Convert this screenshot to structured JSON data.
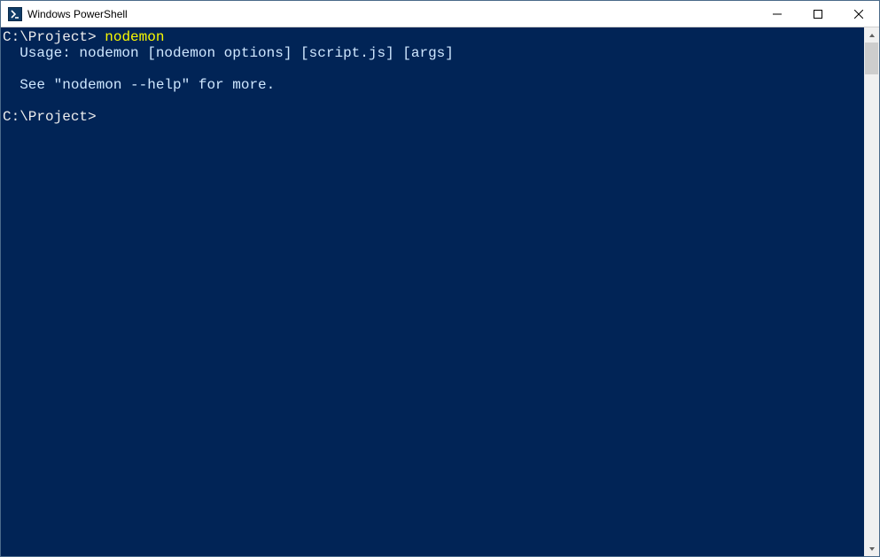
{
  "window": {
    "title": "Windows PowerShell"
  },
  "terminal": {
    "lines": [
      {
        "type": "prompt",
        "prompt": "C:\\Project>",
        "command": "nodemon"
      },
      {
        "type": "output",
        "text": "  Usage: nodemon [nodemon options] [script.js] [args]"
      },
      {
        "type": "blank"
      },
      {
        "type": "output",
        "text": "  See \"nodemon --help\" for more."
      },
      {
        "type": "blank"
      },
      {
        "type": "prompt",
        "prompt": "C:\\Project>",
        "command": ""
      }
    ],
    "background_color": "#012456",
    "prompt_color": "#eeeeee",
    "command_color": "#f9f900",
    "output_color": "#cfe7ff"
  }
}
